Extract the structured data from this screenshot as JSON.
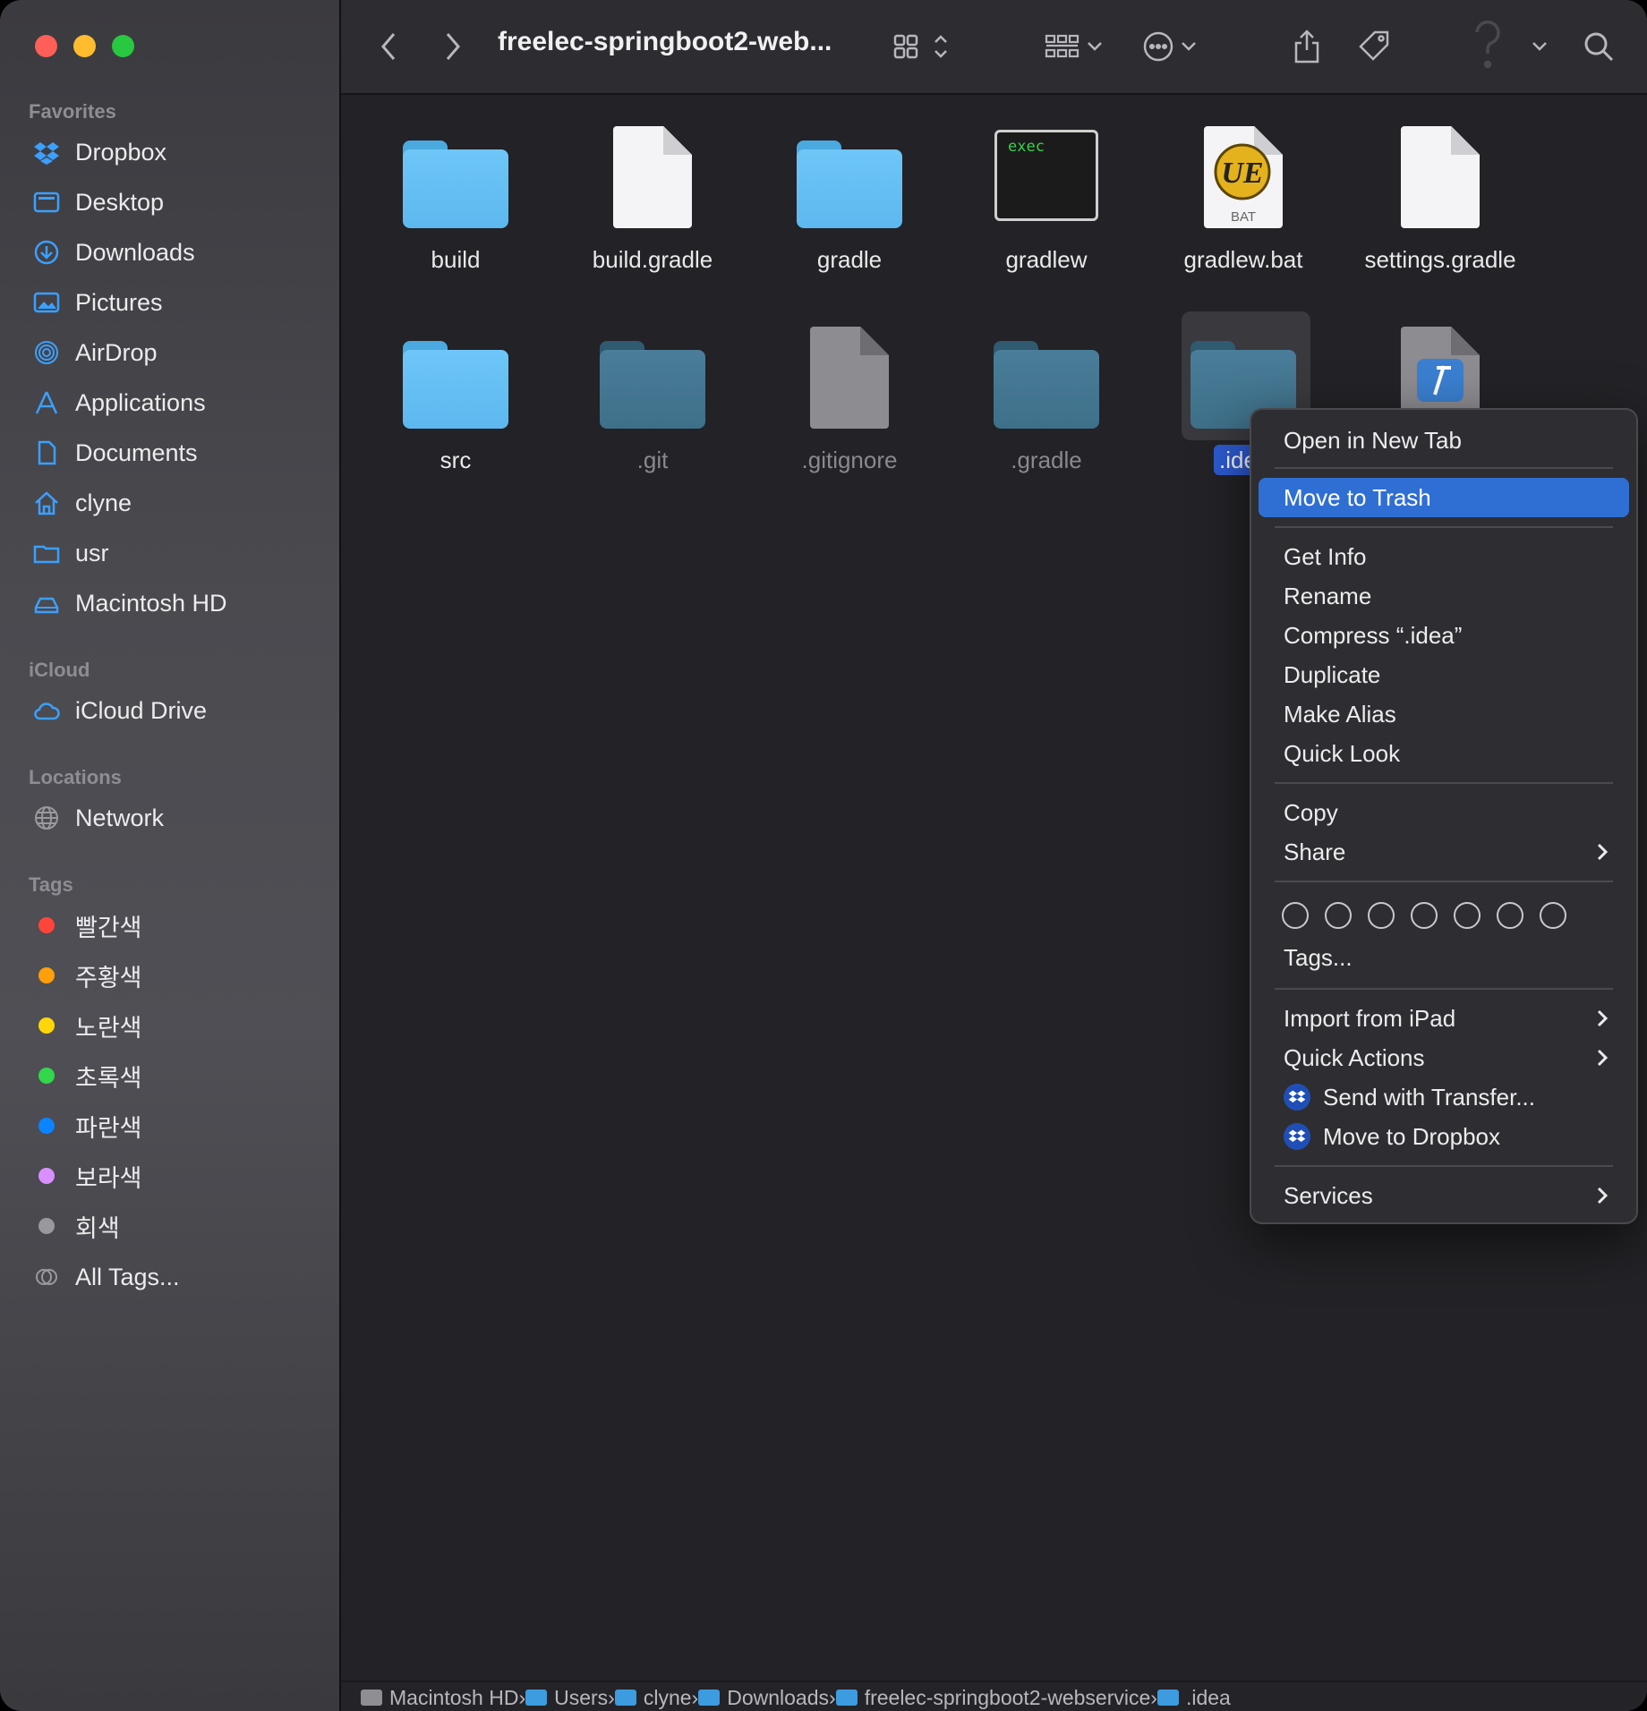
{
  "window": {
    "title": "freelec-springboot2-web..."
  },
  "sidebar": {
    "favorites_header": "Favorites",
    "favorites": [
      {
        "label": "Dropbox",
        "icon": "dropbox-icon"
      },
      {
        "label": "Desktop",
        "icon": "desktop-icon"
      },
      {
        "label": "Downloads",
        "icon": "downloads-icon"
      },
      {
        "label": "Pictures",
        "icon": "pictures-icon"
      },
      {
        "label": "AirDrop",
        "icon": "airdrop-icon"
      },
      {
        "label": "Applications",
        "icon": "applications-icon"
      },
      {
        "label": "Documents",
        "icon": "documents-icon"
      },
      {
        "label": "clyne",
        "icon": "home-icon"
      },
      {
        "label": "usr",
        "icon": "folder-icon"
      },
      {
        "label": "Macintosh HD",
        "icon": "disk-icon"
      }
    ],
    "icloud_header": "iCloud",
    "icloud": [
      {
        "label": "iCloud Drive",
        "icon": "cloud-icon"
      }
    ],
    "locations_header": "Locations",
    "locations": [
      {
        "label": "Network",
        "icon": "globe-icon"
      }
    ],
    "tags_header": "Tags",
    "tags": [
      {
        "label": "빨간색",
        "color": "#ff453a"
      },
      {
        "label": "주황색",
        "color": "#ff9f0a"
      },
      {
        "label": "노란색",
        "color": "#ffd60a"
      },
      {
        "label": "초록색",
        "color": "#32d74b"
      },
      {
        "label": "파란색",
        "color": "#0a84ff"
      },
      {
        "label": "보라색",
        "color": "#da8fff"
      },
      {
        "label": "회색",
        "color": "#98989d"
      },
      {
        "label": "All Tags...",
        "color": ""
      }
    ]
  },
  "files": [
    {
      "name": "build"
    },
    {
      "name": "build.gradle"
    },
    {
      "name": "gradle"
    },
    {
      "name": "gradlew",
      "badge": "exec"
    },
    {
      "name": "gradlew.bat",
      "badge": "BAT"
    },
    {
      "name": "settings.gradle"
    },
    {
      "name": "src"
    },
    {
      "name": ".git"
    },
    {
      "name": ".gitignore"
    },
    {
      "name": ".gradle"
    },
    {
      "name": ".ide"
    }
  ],
  "context_menu": {
    "items": [
      "Open in New Tab",
      "Move to Trash",
      "Get Info",
      "Rename",
      "Compress “.idea”",
      "Duplicate",
      "Make Alias",
      "Quick Look",
      "Copy",
      "Share",
      "Tags...",
      "Import from iPad",
      "Quick Actions",
      "Send with Transfer...",
      "Move to Dropbox",
      "Services"
    ],
    "highlighted": "Move to Trash"
  },
  "pathbar": [
    "Macintosh HD",
    "Users",
    "clyne",
    "Downloads",
    "freelec-springboot2-webservice",
    ".idea"
  ]
}
